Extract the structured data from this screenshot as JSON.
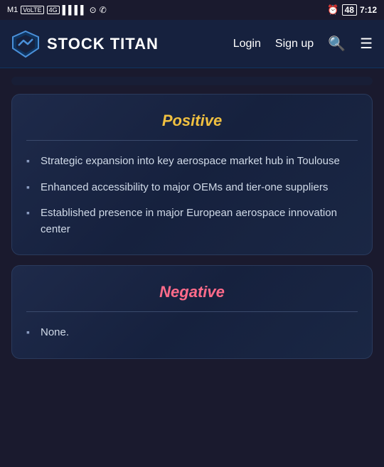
{
  "statusBar": {
    "carrier": "M1",
    "volte": "VoLTE",
    "network": "4G",
    "time": "7:12"
  },
  "navbar": {
    "logoText": "STOCK TITAN",
    "loginLabel": "Login",
    "signupLabel": "Sign up"
  },
  "positive": {
    "title": "Positive",
    "bullets": [
      "Strategic expansion into key aerospace market hub in Toulouse",
      "Enhanced accessibility to major OEMs and tier-one suppliers",
      "Established presence in major European aerospace innovation center"
    ]
  },
  "negative": {
    "title": "Negative",
    "bullets": [
      "None."
    ]
  }
}
